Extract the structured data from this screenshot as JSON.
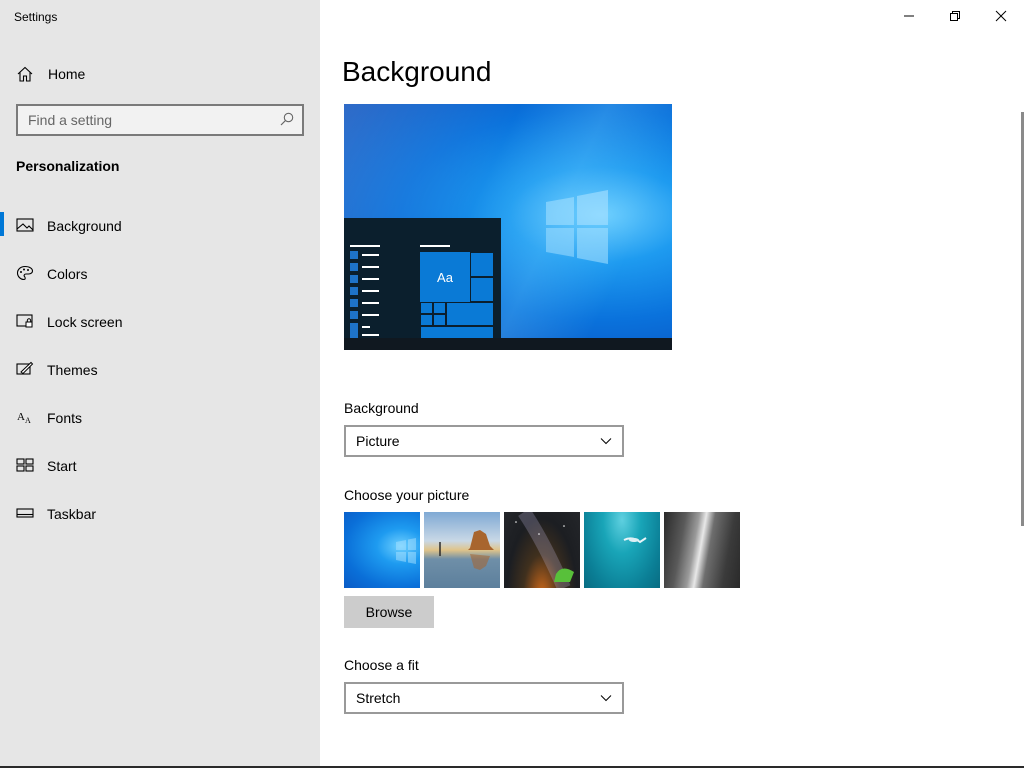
{
  "window": {
    "app_title": "Settings",
    "controls": {
      "minimize_icon": "minimize-icon",
      "maximize_icon": "restore-icon",
      "close_icon": "close-icon"
    }
  },
  "sidebar": {
    "home_label": "Home",
    "search_placeholder": "Find a setting",
    "section_title": "Personalization",
    "items": [
      {
        "label": "Background",
        "icon": "picture-icon",
        "active": true
      },
      {
        "label": "Colors",
        "icon": "palette-icon",
        "active": false
      },
      {
        "label": "Lock screen",
        "icon": "lock-screen-icon",
        "active": false
      },
      {
        "label": "Themes",
        "icon": "themes-icon",
        "active": false
      },
      {
        "label": "Fonts",
        "icon": "fonts-icon",
        "active": false
      },
      {
        "label": "Start",
        "icon": "start-icon",
        "active": false
      },
      {
        "label": "Taskbar",
        "icon": "taskbar-icon",
        "active": false
      }
    ]
  },
  "main": {
    "page_title": "Background",
    "preview": {
      "tile_text": "Aa"
    },
    "background_label": "Background",
    "background_value": "Picture",
    "choose_picture_label": "Choose your picture",
    "pictures": [
      "windows-blue",
      "beach-reflection",
      "night-sky",
      "underwater-swimmer",
      "rock-cliff"
    ],
    "browse_label": "Browse",
    "fit_label": "Choose a fit",
    "fit_value": "Stretch"
  },
  "colors": {
    "accent": "#0078d7",
    "sidebar_bg": "#e6e6e6"
  }
}
